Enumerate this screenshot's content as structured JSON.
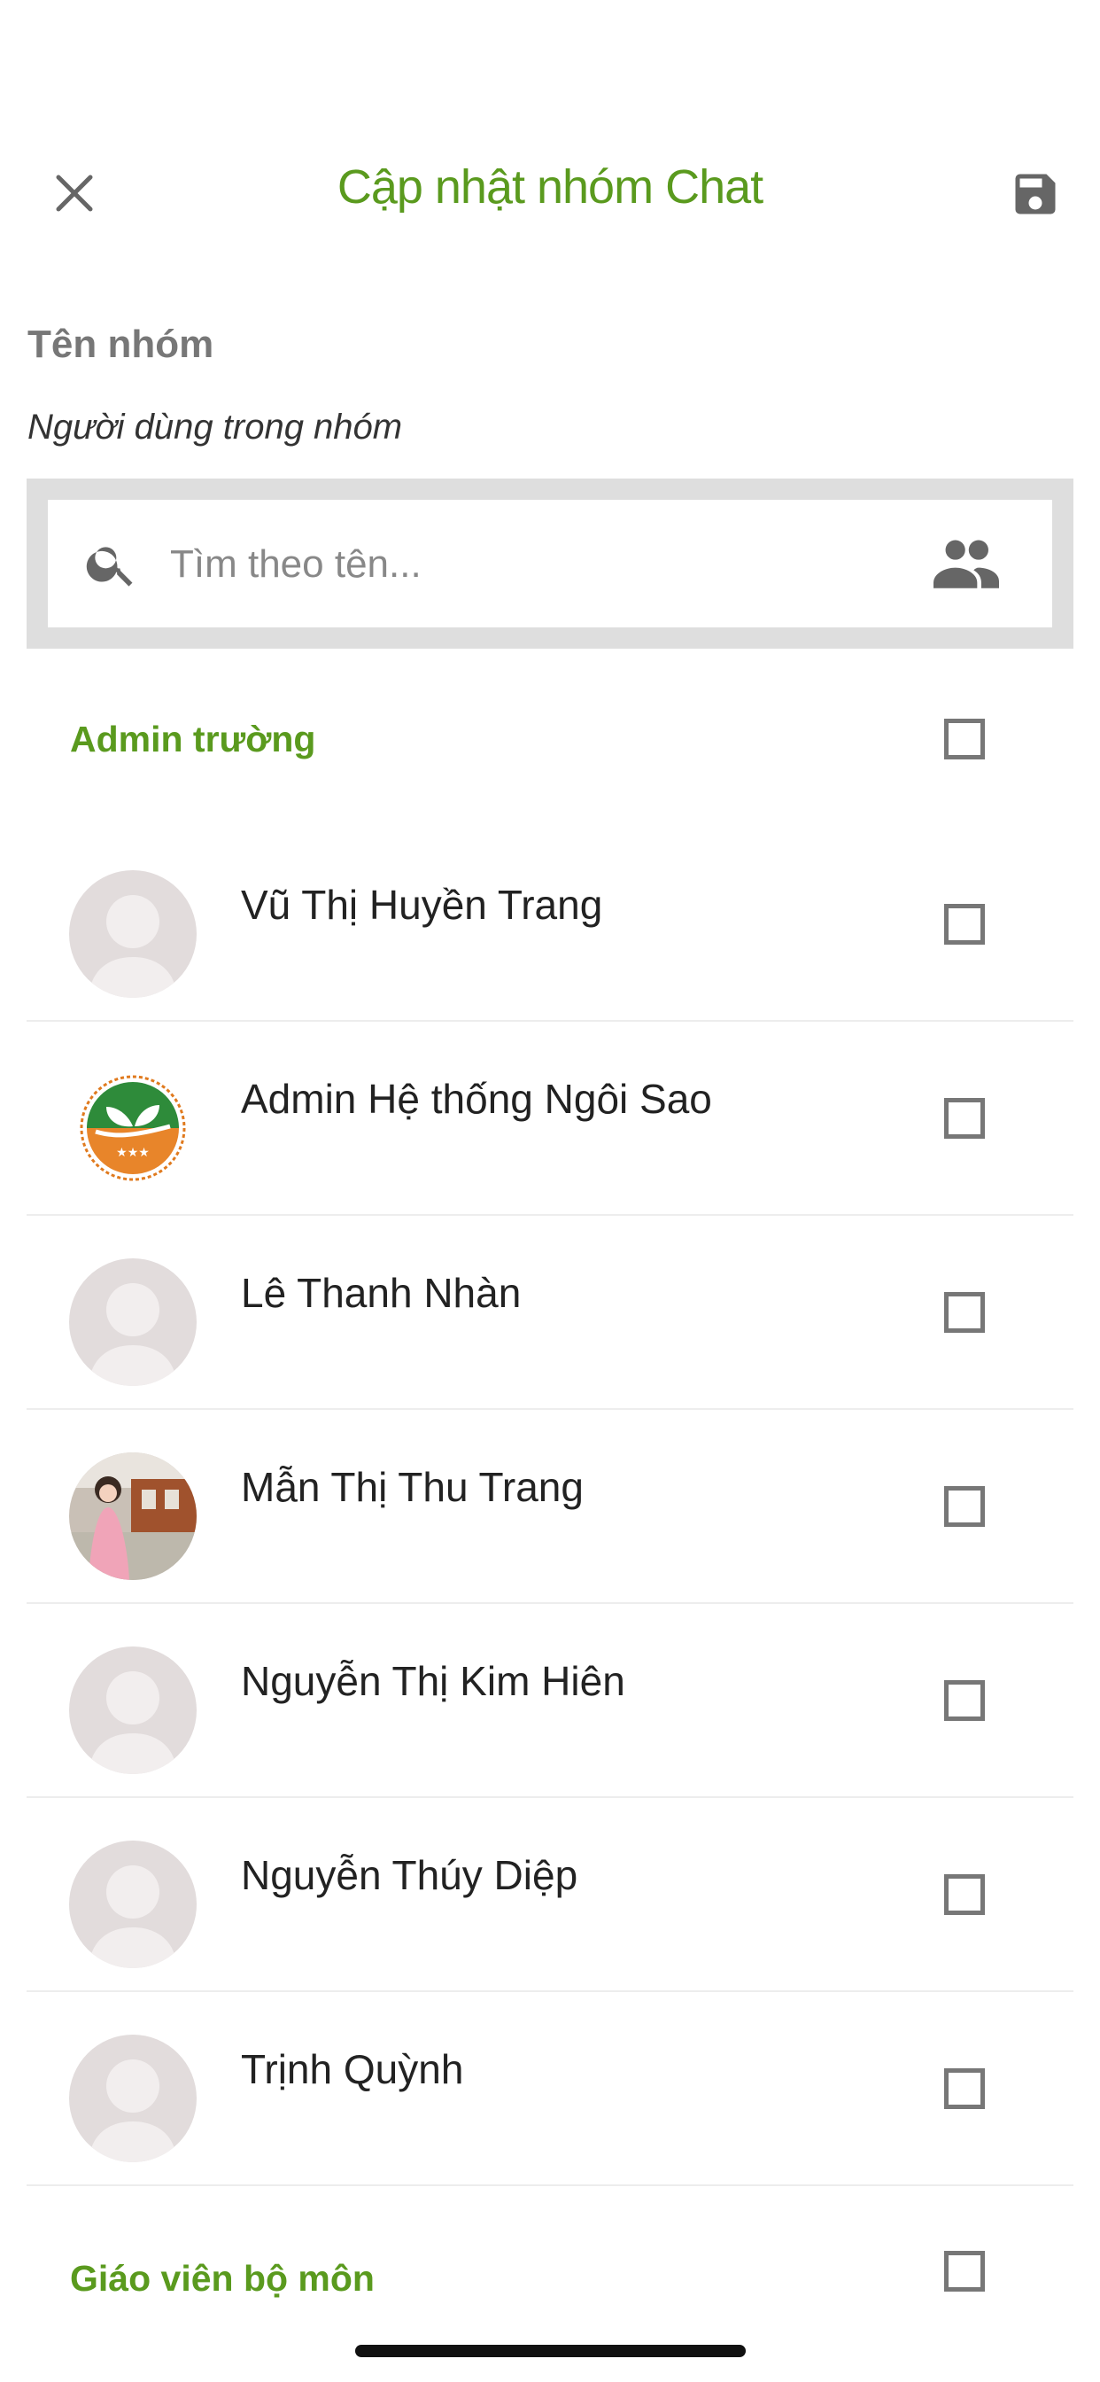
{
  "header": {
    "title": "Cập nhật nhóm Chat",
    "close_icon": "close-icon",
    "save_icon": "floppy-disk-icon"
  },
  "form": {
    "group_name_label": "Tên nhóm",
    "users_label": "Người dùng trong nhóm"
  },
  "search": {
    "placeholder": "Tìm theo tên...",
    "value": ""
  },
  "sections": [
    {
      "title": "Admin trường",
      "checked": false,
      "users": [
        {
          "name": "Vũ Thị Huyền Trang",
          "avatar": "default-avatar",
          "checked": false
        },
        {
          "name": "Admin Hệ thống Ngôi Sao",
          "avatar": "school-logo-avatar",
          "checked": false
        },
        {
          "name": "Lê Thanh Nhàn",
          "avatar": "default-avatar",
          "checked": false
        },
        {
          "name": "Mẫn Thị Thu Trang",
          "avatar": "photo-avatar",
          "checked": false
        },
        {
          "name": "Nguyễn Thị Kim Hiên",
          "avatar": "default-avatar",
          "checked": false
        },
        {
          "name": "Nguyễn Thúy Diệp",
          "avatar": "default-avatar",
          "checked": false
        },
        {
          "name": "Trịnh Quỳnh",
          "avatar": "default-avatar",
          "checked": false
        }
      ]
    },
    {
      "title": "Giáo viên bộ môn",
      "checked": false,
      "users": []
    }
  ],
  "colors": {
    "accent": "#5a9a1e",
    "icon_gray": "#666666",
    "avatar_bg": "#e2dcdc"
  }
}
